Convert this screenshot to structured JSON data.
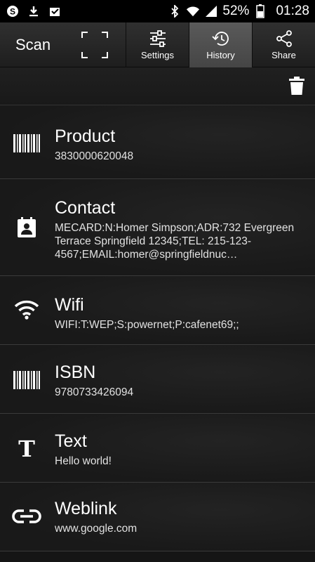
{
  "status_bar": {
    "icons_left": [
      "skype-icon",
      "download-icon",
      "inbox-check-icon"
    ],
    "icons_right": [
      "bluetooth-icon",
      "wifi-icon",
      "signal-icon"
    ],
    "battery": "52%",
    "time": "01:28"
  },
  "toolbar": {
    "scan_label": "Scan",
    "settings_label": "Settings",
    "history_label": "History",
    "share_label": "Share",
    "active_tab": "History"
  },
  "history": [
    {
      "icon": "barcode-icon",
      "title": "Product",
      "value": "3830000620048"
    },
    {
      "icon": "contact-card-icon",
      "title": "Contact",
      "value": "MECARD:N:Homer Simpson;ADR:732 Evergreen Terrace Springfield 12345;TEL: 215-123-4567;EMAIL:homer@springfieldnuc…"
    },
    {
      "icon": "wifi-icon",
      "title": "Wifi",
      "value": "WIFI:T:WEP;S:powernet;P:cafenet69;;"
    },
    {
      "icon": "barcode-icon",
      "title": "ISBN",
      "value": "9780733426094"
    },
    {
      "icon": "text-icon",
      "title": "Text",
      "value": "Hello world!"
    },
    {
      "icon": "link-icon",
      "title": "Weblink",
      "value": "www.google.com"
    }
  ],
  "colors": {
    "background": "#151515",
    "active_tab": "#555555",
    "text": "#ffffff"
  }
}
